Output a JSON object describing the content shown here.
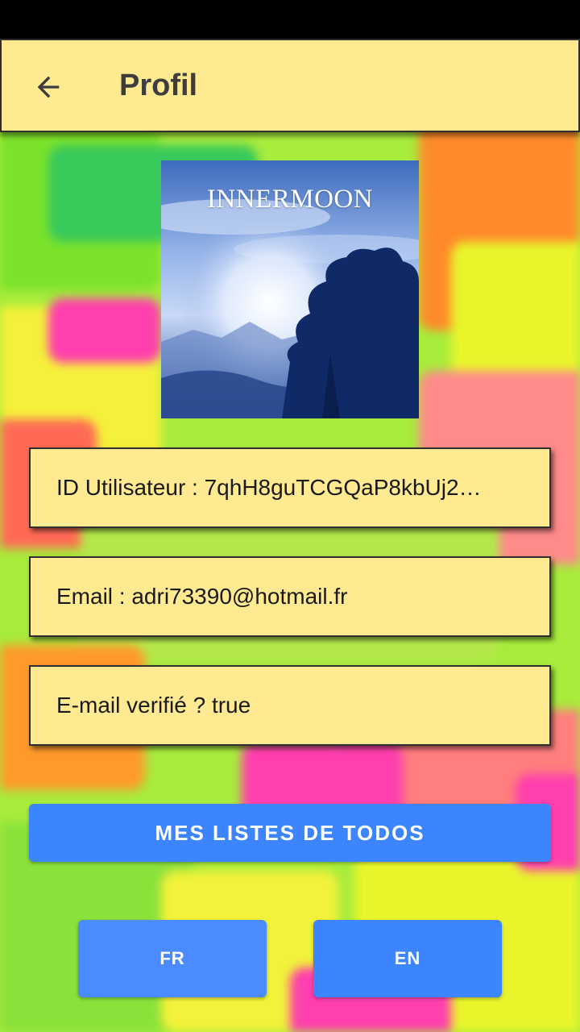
{
  "app_bar": {
    "title": "Profil"
  },
  "avatar": {
    "caption": "INNERMOON"
  },
  "profile": {
    "user_id_text": "ID Utilisateur : 7qhH8guTCGQaP8kbUj2…",
    "email_text": "Email : adri73390@hotmail.fr",
    "verified_text": "E-mail verifié ? true"
  },
  "actions": {
    "todo_lists_label": "MES LISTES DE TODOS",
    "fr_label": "FR",
    "en_label": "EN"
  },
  "colors": {
    "app_bar_bg": "#ffea92",
    "card_bg": "#ffea92",
    "primary_button": "#3d84ff",
    "fr_button": "#4a8cff",
    "en_button": "#3d84ff"
  },
  "icons": {
    "back": "arrow-left-icon"
  }
}
